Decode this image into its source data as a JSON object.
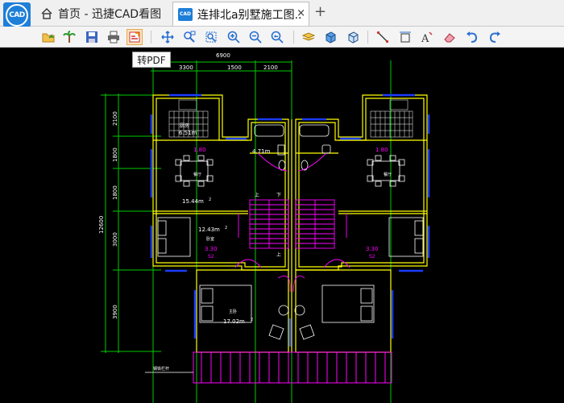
{
  "app": {
    "logo_text": "CAD"
  },
  "tabs": {
    "home_label": "首页 - 迅捷CAD看图",
    "active_label": "连排北a别墅施工图...",
    "active_icon_text": "CAD",
    "close_glyph": "×",
    "new_tab_glyph": "+"
  },
  "toolbar": {
    "tooltip": "转PDF",
    "buttons": [
      "open-folder-icon",
      "palm-tree-icon",
      "save-icon",
      "print-icon",
      "convert-pdf-icon",
      "pan-icon",
      "zoom-window-icon",
      "zoom-extents-icon",
      "zoom-in-icon",
      "zoom-out-icon",
      "zoom-previous-icon",
      "layers-icon",
      "3d-box-icon",
      "3d-orbit-icon",
      "measure-line-icon",
      "measure-dimension-icon",
      "text-icon",
      "eraser-icon",
      "undo-icon",
      "redo-icon"
    ]
  },
  "drawing": {
    "dims_top_total": "6900",
    "dims_top": [
      "3300",
      "1500",
      "2100"
    ],
    "dims_left_total": "12600",
    "dims_left": [
      "2100",
      "1800",
      "1800",
      "3000",
      "3900"
    ],
    "room_labels": {
      "kitchen_name": "厨房",
      "kitchen_area": "6.51m",
      "dining_left_level": "1.80",
      "dining_left_name": "餐厅",
      "dining_left_area": "15.44m",
      "wc_area": "4.71m",
      "dining_right_level": "1.80",
      "dining_right_name": "餐厅",
      "bed_left_area": "12.43m",
      "bed_left_name": "卧室",
      "bed_left_level": "3.30",
      "bed_left_s": "S2",
      "bed_right_level": "3.30",
      "bed_right_s": "S2",
      "master_name": "主卧",
      "master_area": "17.02m",
      "stair_up": "上",
      "stair_down": "下",
      "stair_mid": "上",
      "note": "钢铁栏杆"
    },
    "sup2": "2"
  },
  "colors": {
    "yellow": "#ffff00",
    "magenta": "#ff00ff",
    "cyan": "#00ffff",
    "blue": "#1a3cff",
    "white": "#ffffff",
    "green": "#00cc00"
  }
}
